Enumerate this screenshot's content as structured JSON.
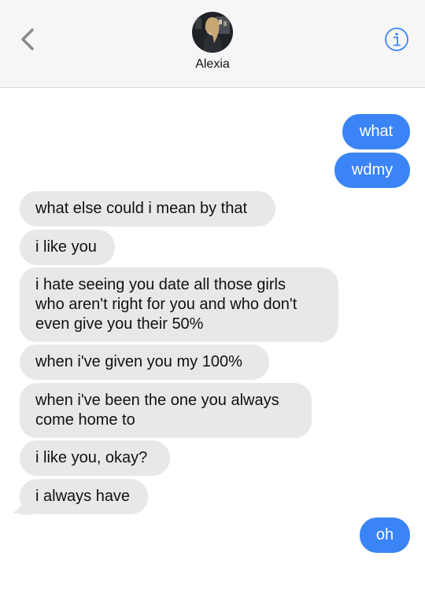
{
  "header": {
    "contact_name": "Alexia",
    "back_icon": "chevron-left-icon",
    "info_icon": "info-icon",
    "accent_color": "#3b84f5"
  },
  "messages": [
    {
      "from": "me",
      "text": "what"
    },
    {
      "from": "me",
      "text": "wdmy"
    },
    {
      "from": "them",
      "text": "what else could i mean by that"
    },
    {
      "from": "them",
      "text": "i like you"
    },
    {
      "from": "them",
      "lines": [
        "i hate seeing you date all those girls",
        "who aren't right for you and who don't",
        "even give you their 50%"
      ]
    },
    {
      "from": "them",
      "text": "when i've given you my 100%"
    },
    {
      "from": "them",
      "lines": [
        "when i've been the one you always",
        "come home to"
      ]
    },
    {
      "from": "them",
      "text": "i like you, okay?"
    },
    {
      "from": "them",
      "text": "i always have"
    },
    {
      "from": "me",
      "text": "oh"
    }
  ]
}
